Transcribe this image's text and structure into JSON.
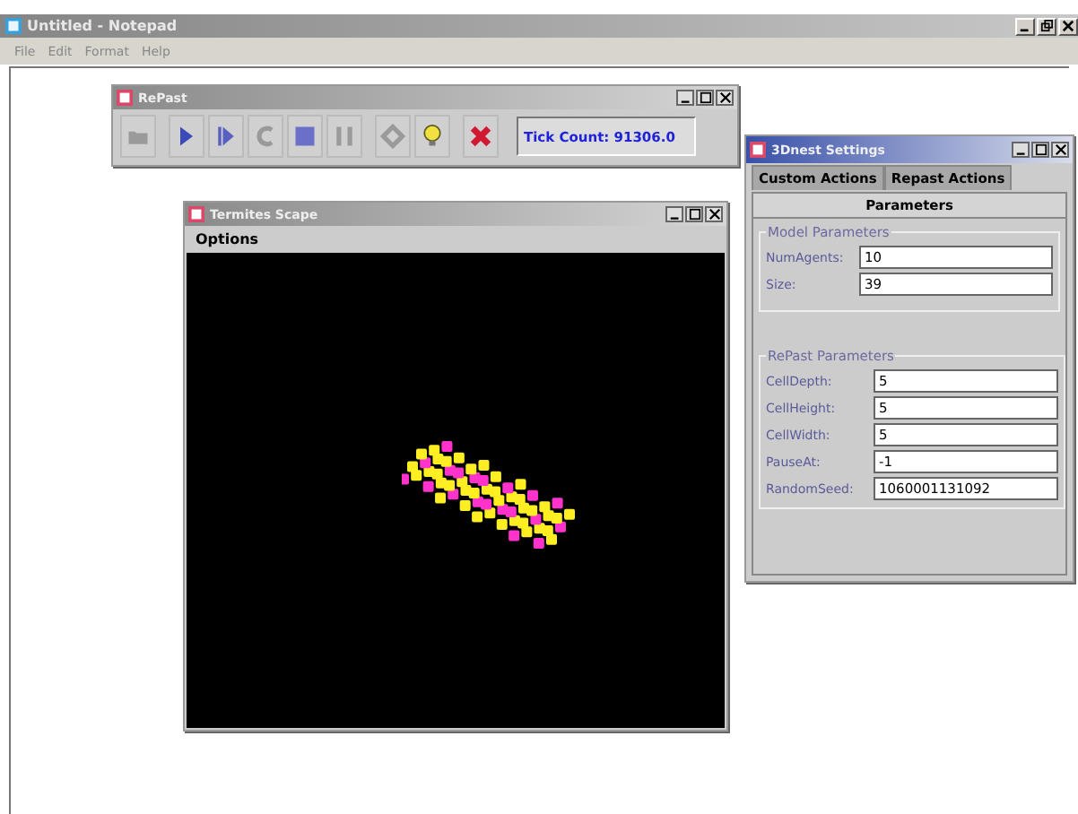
{
  "notepad": {
    "title": "Untitled - Notepad",
    "menu": [
      "File",
      "Edit",
      "Format",
      "Help"
    ]
  },
  "repast": {
    "title": "RePast",
    "toolbar": [
      {
        "kind": "folder",
        "disabled": true
      },
      {
        "kind": "play",
        "disabled": false
      },
      {
        "kind": "step",
        "disabled": false
      },
      {
        "kind": "reload",
        "disabled": true
      },
      {
        "kind": "stop",
        "disabled": false
      },
      {
        "kind": "pause",
        "disabled": true
      },
      {
        "kind": "setup",
        "disabled": true
      },
      {
        "kind": "bulb",
        "disabled": false
      },
      {
        "kind": "exit",
        "disabled": false
      }
    ],
    "tick_count": "Tick Count: 91306.0"
  },
  "scape": {
    "title": "Termites Scape",
    "menu": [
      "Options"
    ]
  },
  "settings": {
    "title": "3Dnest Settings",
    "tabs": [
      {
        "label": "Custom Actions",
        "selected": false
      },
      {
        "label": "Repast Actions",
        "selected": false
      },
      {
        "label": "Parameters",
        "selected": true
      }
    ],
    "groups": [
      {
        "title": "Model Parameters",
        "fields": [
          {
            "label": "NumAgents:",
            "value": "10"
          },
          {
            "label": "Size:",
            "value": "39"
          }
        ]
      },
      {
        "title": "RePast Parameters",
        "fields": [
          {
            "label": "CellDepth:",
            "value": "5"
          },
          {
            "label": "CellHeight:",
            "value": "5"
          },
          {
            "label": "CellWidth:",
            "value": "5"
          },
          {
            "label": "PauseAt:",
            "value": "-1"
          },
          {
            "label": "RandomSeed:",
            "value": "1060001131092"
          }
        ]
      }
    ]
  }
}
